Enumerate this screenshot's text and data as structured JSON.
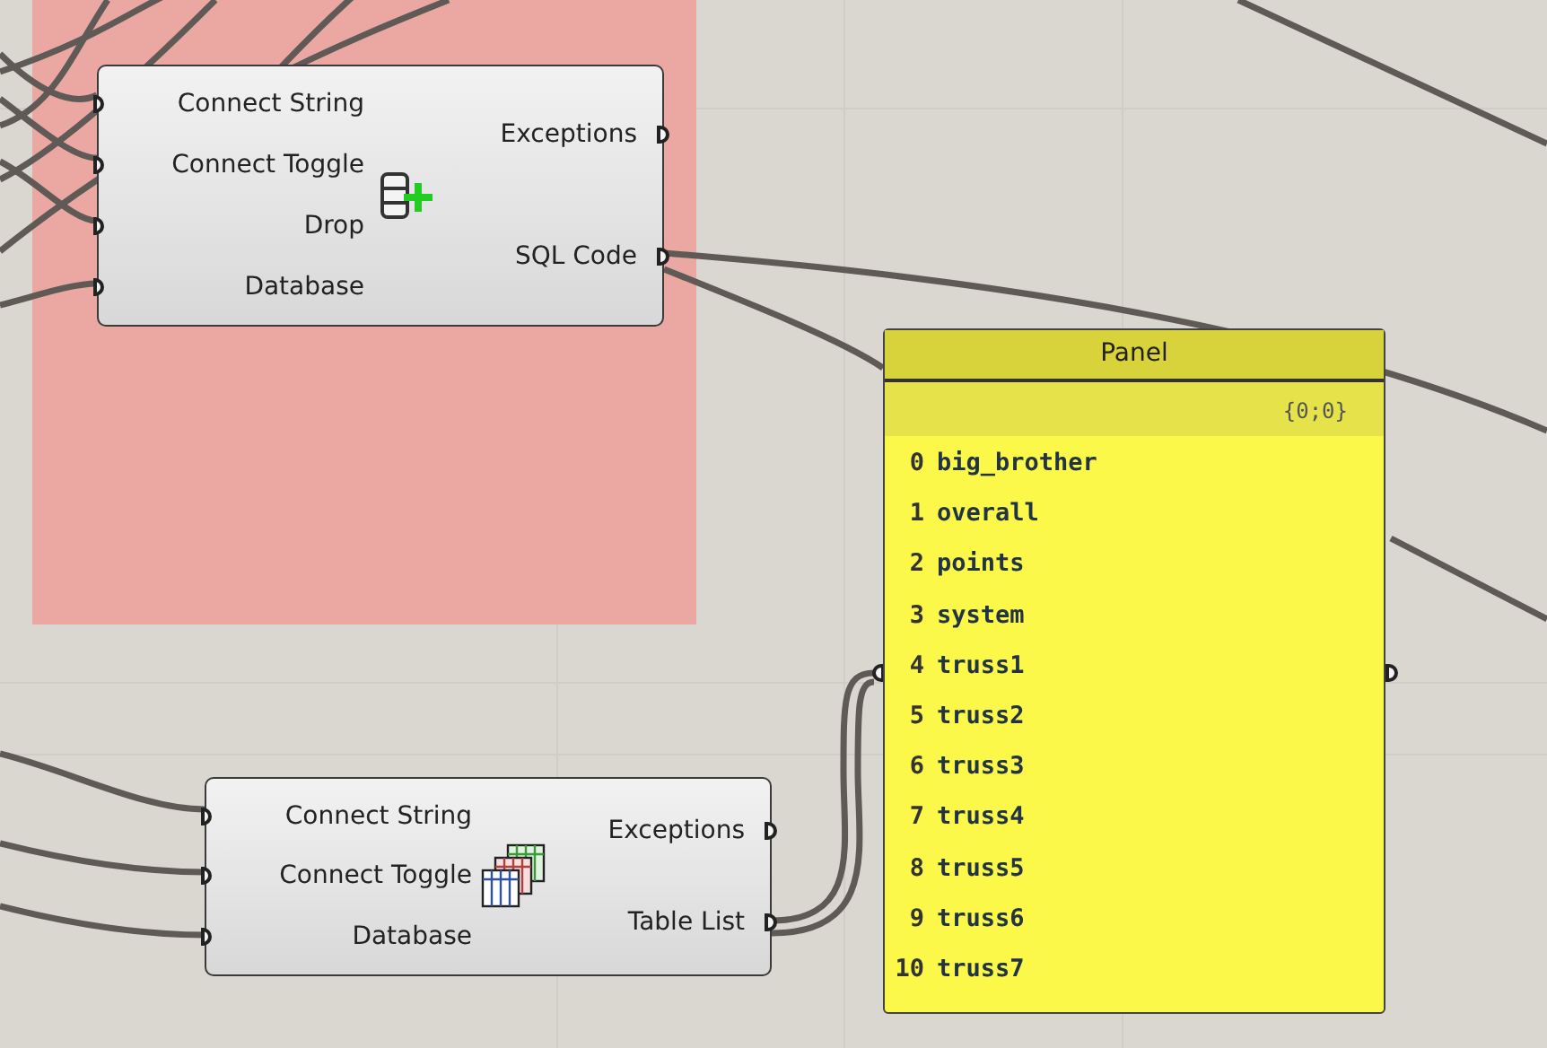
{
  "components": [
    {
      "inputs": [
        "Connect String",
        "Connect Toggle",
        "Drop",
        "Database"
      ],
      "outputs": [
        "Exceptions",
        "SQL Code"
      ]
    },
    {
      "inputs": [
        "Connect String",
        "Connect Toggle",
        "Database"
      ],
      "outputs": [
        "Exceptions",
        "Table List"
      ]
    }
  ],
  "panel": {
    "title": "Panel",
    "path": "{0;0}",
    "items": [
      {
        "index": "0",
        "text": "big_brother"
      },
      {
        "index": "1",
        "text": "overall"
      },
      {
        "index": "2",
        "text": "points"
      },
      {
        "index": "3",
        "text": "system"
      },
      {
        "index": "4",
        "text": "truss1"
      },
      {
        "index": "5",
        "text": "truss2"
      },
      {
        "index": "6",
        "text": "truss3"
      },
      {
        "index": "7",
        "text": "truss4"
      },
      {
        "index": "8",
        "text": "truss5"
      },
      {
        "index": "9",
        "text": "truss6"
      },
      {
        "index": "10",
        "text": "truss7"
      }
    ]
  }
}
